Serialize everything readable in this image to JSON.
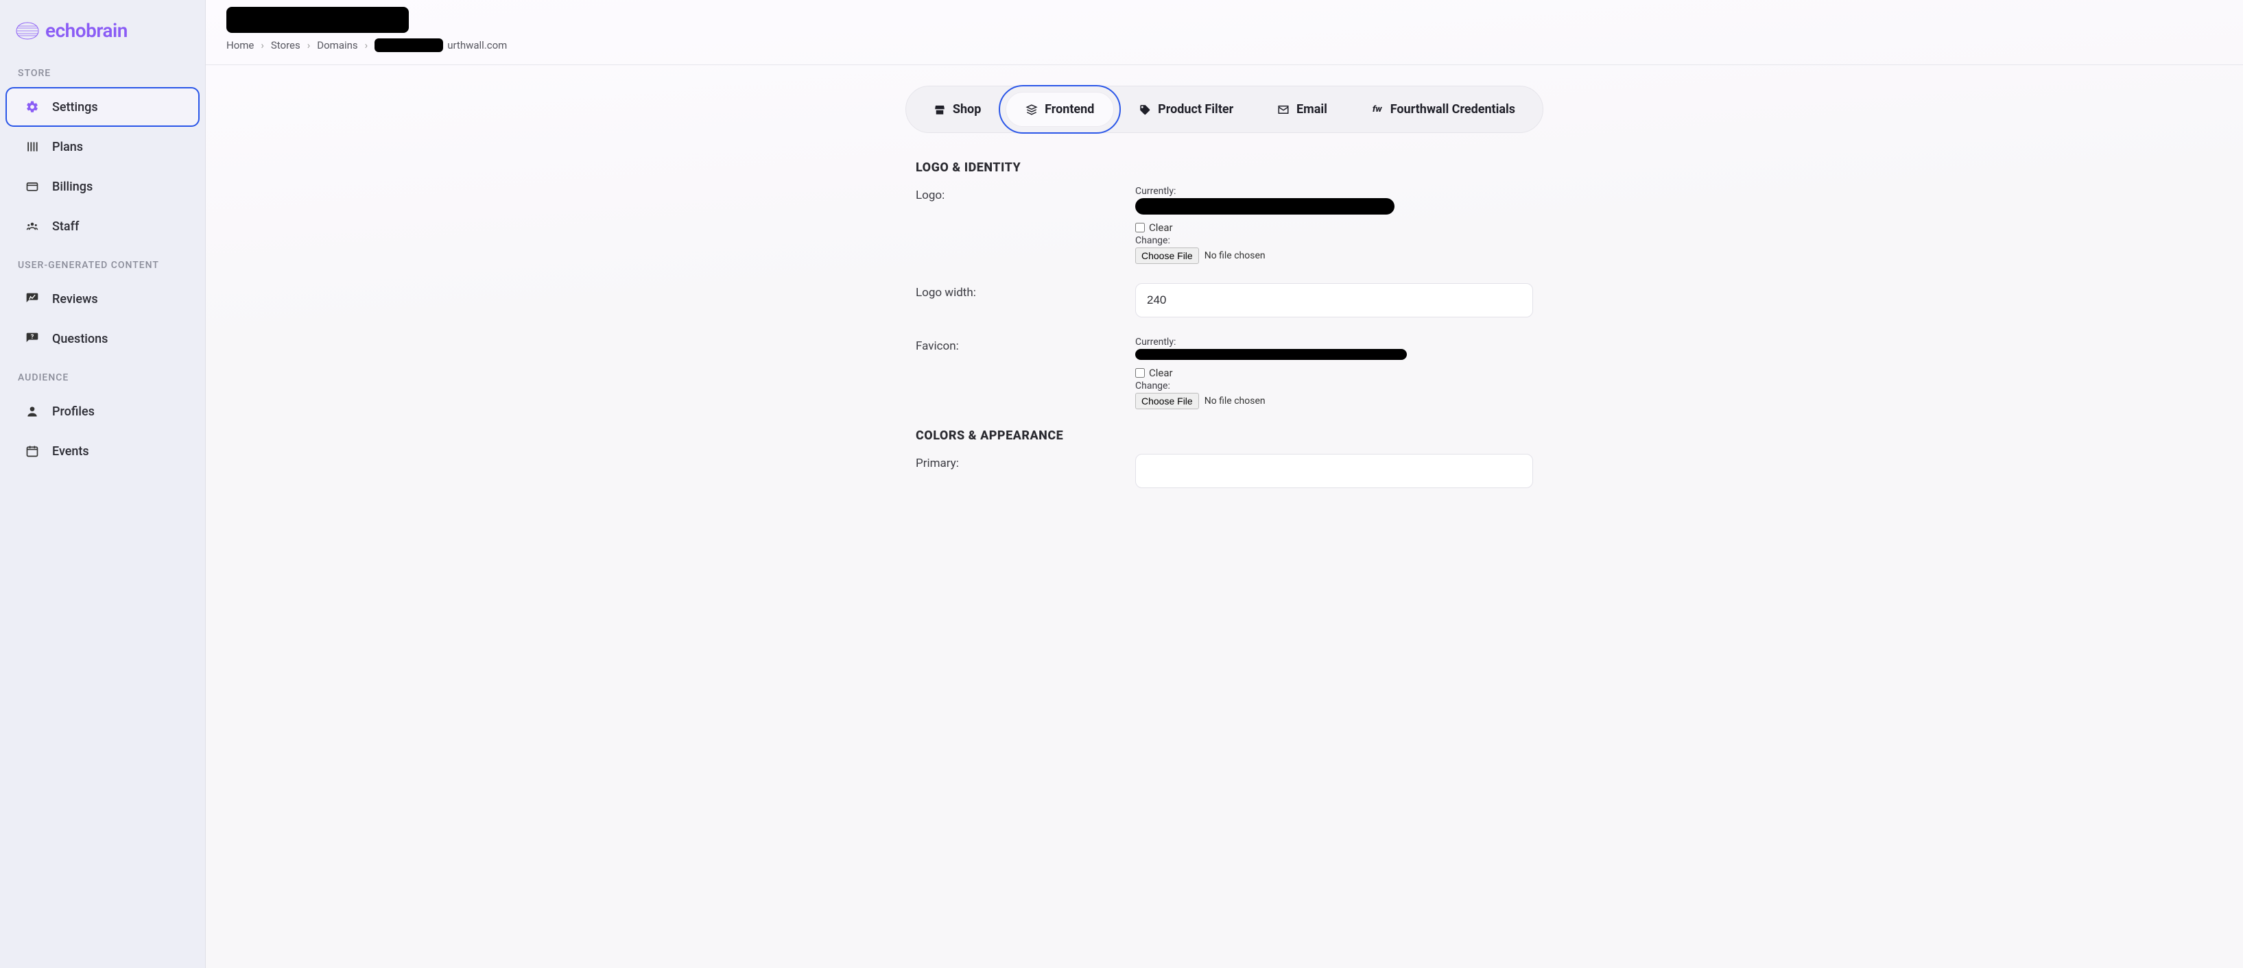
{
  "brand": {
    "name": "echobrain"
  },
  "sidebar": {
    "sections": [
      {
        "label": "STORE",
        "items": [
          {
            "label": "Settings",
            "icon": "gear-icon",
            "active": true
          },
          {
            "label": "Plans",
            "icon": "bars-icon"
          },
          {
            "label": "Billings",
            "icon": "card-icon"
          },
          {
            "label": "Staff",
            "icon": "people-icon"
          }
        ]
      },
      {
        "label": "USER-GENERATED CONTENT",
        "items": [
          {
            "label": "Reviews",
            "icon": "review-icon"
          },
          {
            "label": "Questions",
            "icon": "question-icon"
          }
        ]
      },
      {
        "label": "AUDIENCE",
        "items": [
          {
            "label": "Profiles",
            "icon": "person-icon"
          },
          {
            "label": "Events",
            "icon": "calendar-icon"
          }
        ]
      }
    ]
  },
  "breadcrumb": {
    "items": [
      "Home",
      "Stores",
      "Domains"
    ],
    "tail": "urthwall.com"
  },
  "tabs": [
    {
      "label": "Shop",
      "icon": "store-icon"
    },
    {
      "label": "Frontend",
      "icon": "style-icon",
      "active": true
    },
    {
      "label": "Product Filter",
      "icon": "tag-icon"
    },
    {
      "label": "Email",
      "icon": "email-icon"
    },
    {
      "label": "Fourthwall Credentials",
      "icon": "fw-icon"
    }
  ],
  "form": {
    "section_logo_heading": "LOGO & IDENTITY",
    "section_colors_heading": "COLORS & APPEARANCE",
    "logo_label": "Logo:",
    "logo_width_label": "Logo width:",
    "logo_width_value": "240",
    "favicon_label": "Favicon:",
    "primary_label": "Primary:",
    "currently_label": "Currently:",
    "clear_label": "Clear",
    "change_label": "Change:",
    "choose_file_label": "Choose File",
    "no_file_label": "No file chosen"
  }
}
